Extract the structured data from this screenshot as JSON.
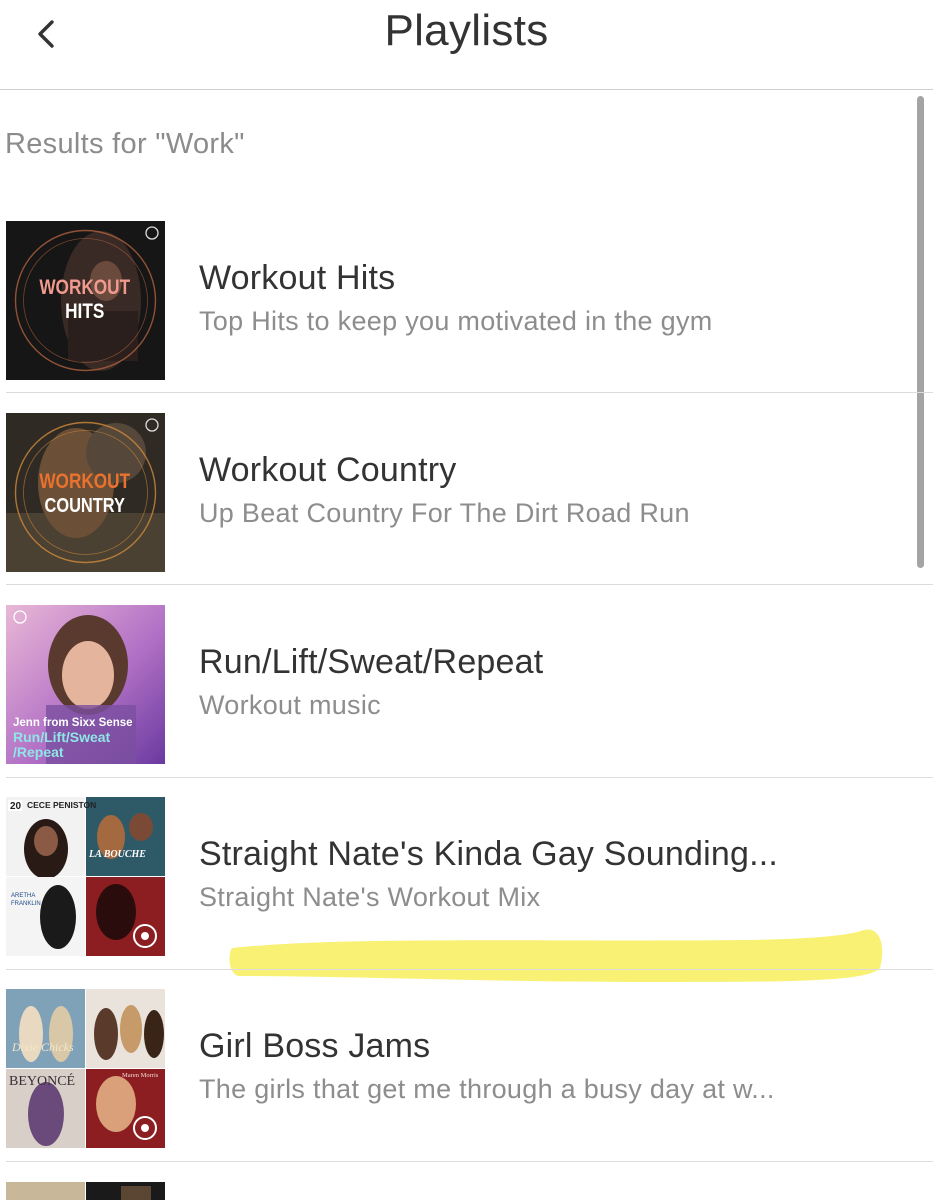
{
  "header": {
    "title": "Playlists",
    "back_icon": "chevron-left-icon"
  },
  "search": {
    "results_label": "Results for \"Work\""
  },
  "playlists": [
    {
      "title": "Workout Hits",
      "subtitle": "Top Hits to keep you motivated in the gym",
      "art_line1": "WORKOUT",
      "art_line2": "HITS"
    },
    {
      "title": "Workout Country",
      "subtitle": "Up Beat Country For The Dirt Road Run",
      "art_line1": "WORKOUT",
      "art_line2": "COUNTRY"
    },
    {
      "title": "Run/Lift/Sweat/Repeat",
      "subtitle": "Workout music",
      "art_line1": "Jenn from Sixx Sense",
      "art_line2": "Run/Lift/Sweat",
      "art_line3": "/Repeat"
    },
    {
      "title": "Straight Nate's Kinda Gay Sounding...",
      "subtitle": "Straight Nate's Workout Mix",
      "art_tl": "CECE PENISTON",
      "art_tl_badge": "20",
      "art_tr": "LA BOUCHE",
      "art_bl1": "ARETHA",
      "art_bl2": "FRANKLIN"
    },
    {
      "title": "Girl Boss Jams",
      "subtitle": "The girls that get me through a busy day at w...",
      "art_tl": "Dixie Chicks",
      "art_bl": "BEYONCÉ",
      "art_br": "Maren Morris"
    }
  ],
  "colors": {
    "highlight": "#f7ef5a",
    "divider": "#dcdcdc",
    "subtitle": "#8d8d8d"
  }
}
